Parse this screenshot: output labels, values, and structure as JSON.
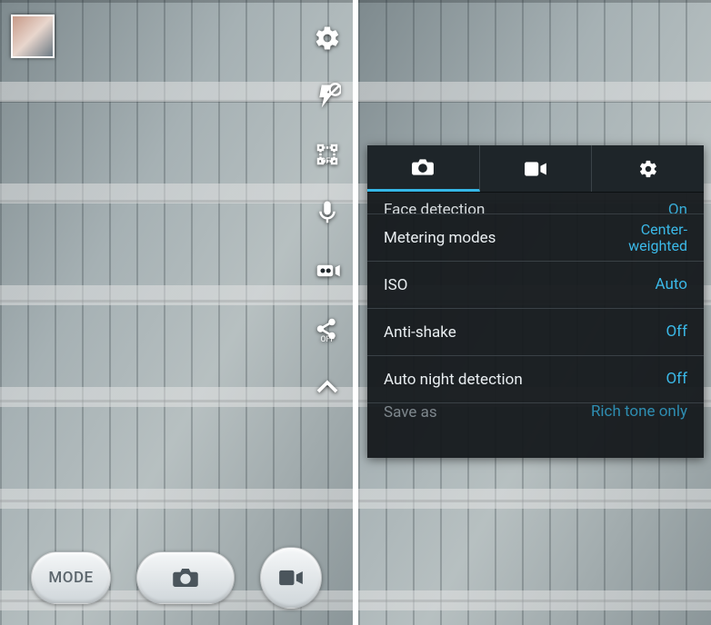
{
  "left": {
    "mode_label": "MODE",
    "quick_icons": [
      "settings",
      "flash-off",
      "timer-off",
      "mic",
      "effects",
      "switch-camera",
      "chevron-up"
    ]
  },
  "settings_panel": {
    "tabs": [
      "camera",
      "video",
      "gear"
    ],
    "active_tab_index": 0,
    "rows": [
      {
        "label": "Face detection",
        "value": "On",
        "cut": "top"
      },
      {
        "label": "Metering modes",
        "value": "Center-\nweighted"
      },
      {
        "label": "ISO",
        "value": "Auto"
      },
      {
        "label": "Anti-shake",
        "value": "Off"
      },
      {
        "label": "Auto night detection",
        "value": "Off"
      },
      {
        "label": "Save as",
        "value": "Rich tone only",
        "cut": "bottom"
      }
    ]
  }
}
